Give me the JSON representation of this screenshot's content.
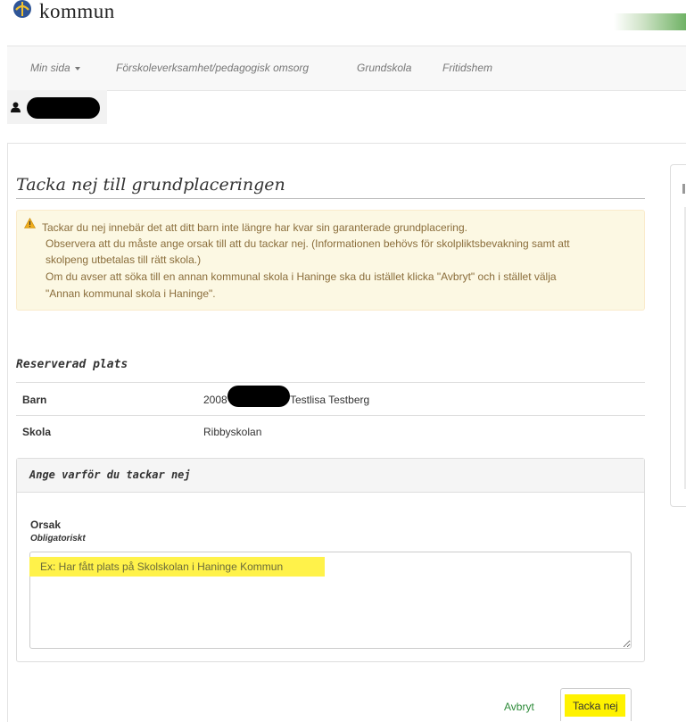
{
  "header": {
    "brand_text": "kommun"
  },
  "nav": {
    "items": [
      {
        "label": "Min sida"
      },
      {
        "label": "Förskoleverksamhet/pedagogisk omsorg"
      },
      {
        "label": "Grundskola"
      },
      {
        "label": "Fritidshem"
      }
    ]
  },
  "page": {
    "title": "Tacka nej till grundplaceringen",
    "alert_lines": [
      "Tackar du nej innebär det att ditt barn inte längre har kvar sin garanterade grundplacering.",
      "Observera att du måste ange orsak till att du tackar nej. (Informationen behövs för skolpliktsbevakning samt att",
      "skolpeng utbetalas till rätt skola.)",
      "Om du avser att söka till en annan kommunal skola i Haninge ska du istället klicka \"Avbryt\" och i stället välja",
      "\"Annan kommunal skola i Haninge\"."
    ]
  },
  "reserved": {
    "title": "Reserverad plats",
    "rows": [
      {
        "label": "Barn",
        "value_prefix": "2008",
        "value": "Testlisa Testberg"
      },
      {
        "label": "Skola",
        "value": "Ribbyskolan"
      }
    ]
  },
  "form": {
    "title": "Ange varför du tackar nej",
    "field_label": "Orsak",
    "field_required": "Obligatoriskt",
    "placeholder": "Ex: Har fått plats på Skolskolan i Haninge Kommun",
    "cancel_label": "Avbryt",
    "submit_label": "Tacka nej"
  },
  "colors": {
    "alert_bg": "#fcf8e3",
    "alert_text": "#8a6d3b",
    "highlight": "#fff200",
    "link": "#2e8b3a"
  }
}
